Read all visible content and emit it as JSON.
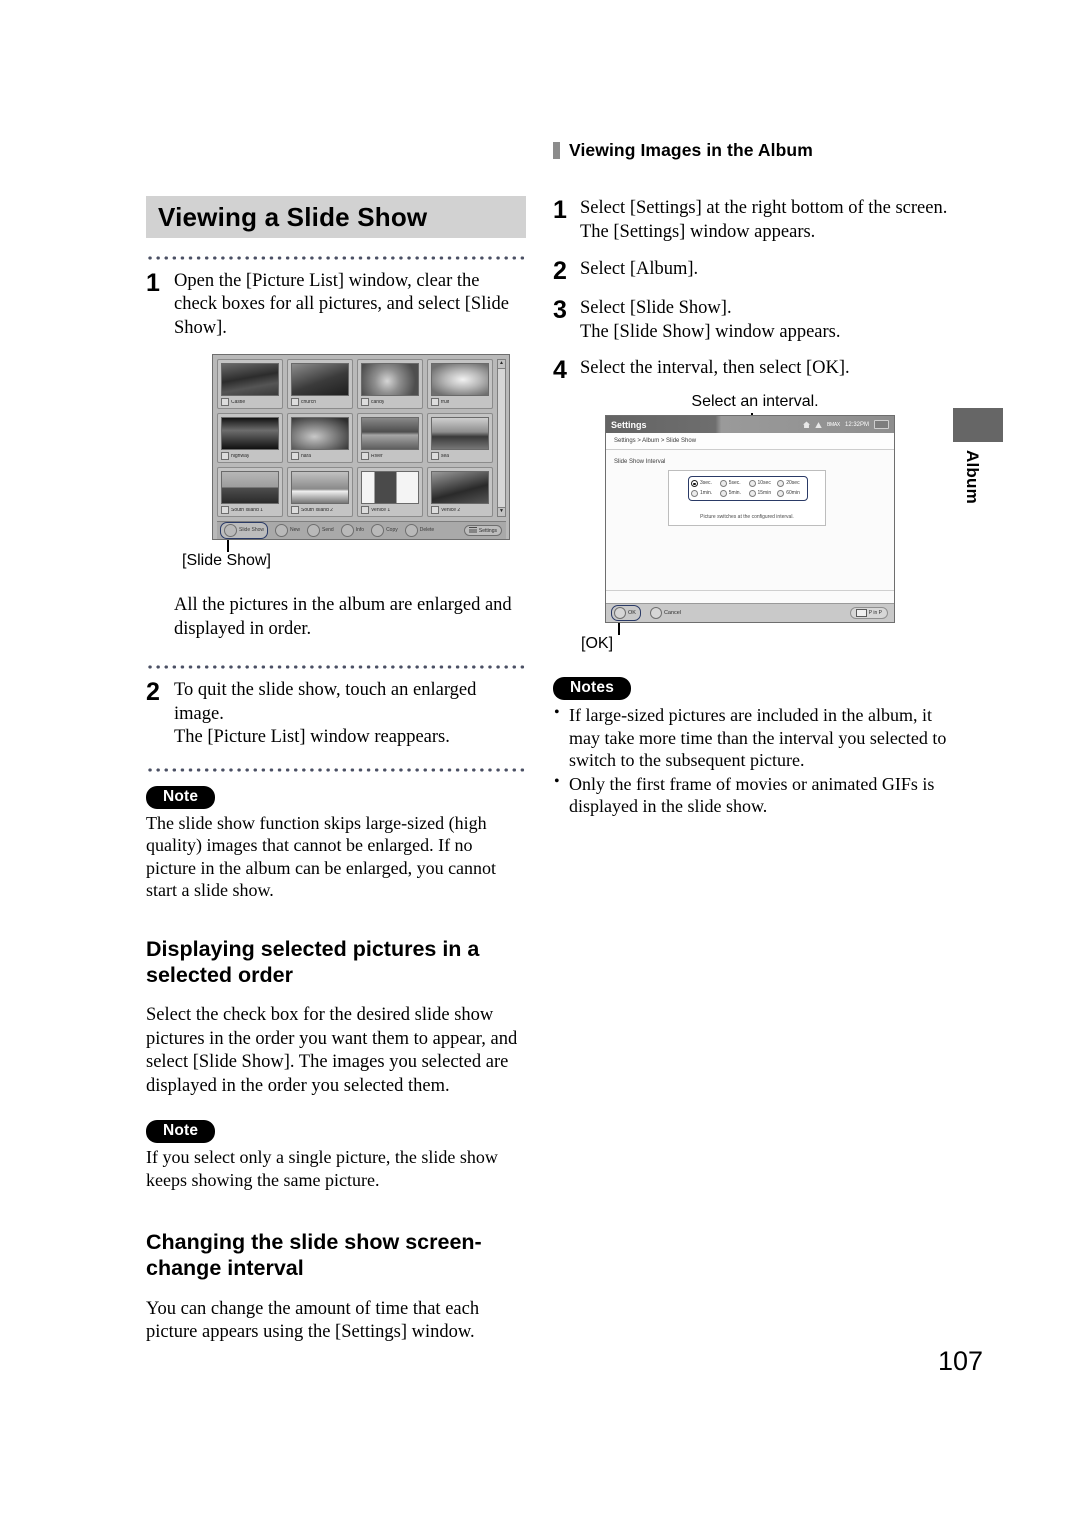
{
  "page": {
    "number": "107",
    "side_tab_label": "Album"
  },
  "running_head": {
    "text": "Viewing Images in the Album"
  },
  "left_column": {
    "title": "Viewing a Slide Show",
    "steps": [
      {
        "number": "1",
        "lines": [
          "Open the [Picture List] window, clear the check boxes for all pictures, and select [Slide Show]."
        ]
      },
      {
        "number": "2",
        "lines": [
          "To quit the slide show, touch an enlarged image.",
          "The [Picture List] window reappears."
        ]
      }
    ],
    "figure_caption": "[Slide Show]",
    "after_figure_text": "All the pictures in the album are enlarged and displayed in order.",
    "note1": {
      "badge": "Note",
      "text": "The slide show function skips large-sized (high quality) images that cannot be enlarged. If no picture in the album can be enlarged, you cannot start a slide show."
    },
    "subhead1": "Displaying selected pictures in a selected order",
    "subhead1_body": "Select the check box for the desired slide show pictures in the order you want them to appear, and select [Slide Show]. The images you selected are displayed in the order you selected them.",
    "note2": {
      "badge": "Note",
      "text": "If you select only a single picture, the slide show keeps showing the same picture."
    },
    "subhead2": "Changing the slide show screen-change interval",
    "subhead2_body": "You can change the amount of time that each picture appears using the [Settings] window."
  },
  "picture_list_window": {
    "thumbnails": [
      {
        "label": "Castle"
      },
      {
        "label": "church"
      },
      {
        "label": "candy"
      },
      {
        "label": "fruit"
      },
      {
        "label": "highway"
      },
      {
        "label": "nara"
      },
      {
        "label": "River"
      },
      {
        "label": "sea"
      },
      {
        "label": "South Island 1"
      },
      {
        "label": "South Island 2"
      },
      {
        "label": "Venice 1"
      },
      {
        "label": "Venice 2"
      }
    ],
    "toolbar": [
      {
        "label": "Slide Show",
        "icon": "slide-show-icon",
        "highlighted": true
      },
      {
        "label": "New",
        "icon": "new-icon",
        "highlighted": false
      },
      {
        "label": "Send",
        "icon": "send-icon",
        "highlighted": false
      },
      {
        "label": "Info",
        "icon": "info-icon",
        "highlighted": false
      },
      {
        "label": "Copy",
        "icon": "copy-icon",
        "highlighted": false
      },
      {
        "label": "Delete",
        "icon": "delete-icon",
        "highlighted": false
      }
    ],
    "settings_button": "Settings",
    "scroll_up": "▲",
    "scroll_down": "▼"
  },
  "right_column": {
    "steps": [
      {
        "number": "1",
        "lines": [
          "Select [Settings] at the right bottom of the screen.",
          "The [Settings] window appears."
        ]
      },
      {
        "number": "2",
        "lines": [
          "Select [Album]."
        ]
      },
      {
        "number": "3",
        "lines": [
          "Select [Slide Show].",
          "The [Slide Show] window appears."
        ]
      },
      {
        "number": "4",
        "lines": [
          "Select the interval, then select [OK]."
        ]
      }
    ],
    "figure_top_caption": "Select an interval.",
    "figure_bottom_caption": "[OK]",
    "notes": {
      "badge": "Notes",
      "items": [
        "If large-sized pictures are included in the album, it may take more time than the interval you selected to switch to the subsequent picture.",
        "Only the first frame of movies or animated GIFs is displayed in the slide show."
      ]
    }
  },
  "settings_window": {
    "title": "Settings",
    "status": {
      "home_icon": "home-icon",
      "network_icon": "network-icon",
      "signal": "BMAX",
      "time": "12:32PM",
      "battery_icon": "battery-icon"
    },
    "breadcrumb": "Settings > Album > Slide Show",
    "field_label": "Slide Show Interval",
    "intervals": [
      {
        "label": "3sec.",
        "selected": true
      },
      {
        "label": "5sec.",
        "selected": false
      },
      {
        "label": "10sec",
        "selected": false
      },
      {
        "label": "20sec",
        "selected": false
      },
      {
        "label": "1min.",
        "selected": false
      },
      {
        "label": "5min.",
        "selected": false
      },
      {
        "label": "15min",
        "selected": false
      },
      {
        "label": "60min",
        "selected": false
      }
    ],
    "hint": "Picture switches at the configured interval.",
    "ok_button": "OK",
    "cancel_button": "Cancel",
    "pip_button": "P in P"
  }
}
